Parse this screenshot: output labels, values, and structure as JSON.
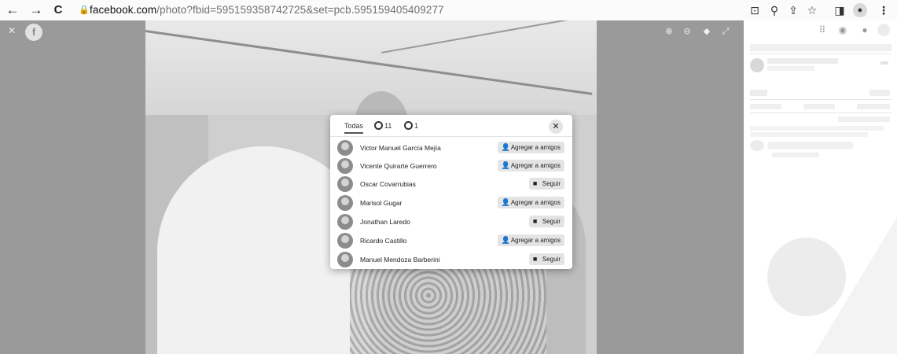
{
  "browser": {
    "back_icon": "←",
    "forward_icon": "→",
    "reload_icon": "C",
    "lock_icon": "🔒",
    "address_host": "facebook.com",
    "address_path": "/photo?fbid=595159358742725&set=pcb.595159405409277",
    "toolbar_icons": [
      "install-icon",
      "zoom-icon",
      "share-icon",
      "bookmark-star-icon",
      "sidebar-icon",
      "profile-icon",
      "menu-icon"
    ]
  },
  "viewer": {
    "close_icon": "✕",
    "logo_letter": "f",
    "controls": [
      "zoom-in-icon",
      "zoom-out-icon",
      "tag-icon",
      "fullscreen-icon"
    ]
  },
  "dialog": {
    "tabs": [
      {
        "label": "Todas",
        "active": true
      },
      {
        "label": "11",
        "icon": "reaction-icon"
      },
      {
        "label": "1",
        "icon": "reaction-icon"
      }
    ],
    "close_label": "✕",
    "people": [
      {
        "name": "Victor Manuel García Mejía",
        "action": "Agregar a amigos",
        "type": "add"
      },
      {
        "name": "Vicente Quirarte Guerrero",
        "action": "Agregar a amigos",
        "type": "add"
      },
      {
        "name": "Oscar Covarrubias",
        "action": "Seguir",
        "type": "follow"
      },
      {
        "name": "Marisol Gugar",
        "action": "Agregar a amigos",
        "type": "add"
      },
      {
        "name": "Jonathan Laredo",
        "action": "Seguir",
        "type": "follow"
      },
      {
        "name": "Ricardo Castillo",
        "action": "Agregar a amigos",
        "type": "add"
      },
      {
        "name": "Manuel Mendoza Barberini",
        "action": "Seguir",
        "type": "follow"
      }
    ]
  }
}
